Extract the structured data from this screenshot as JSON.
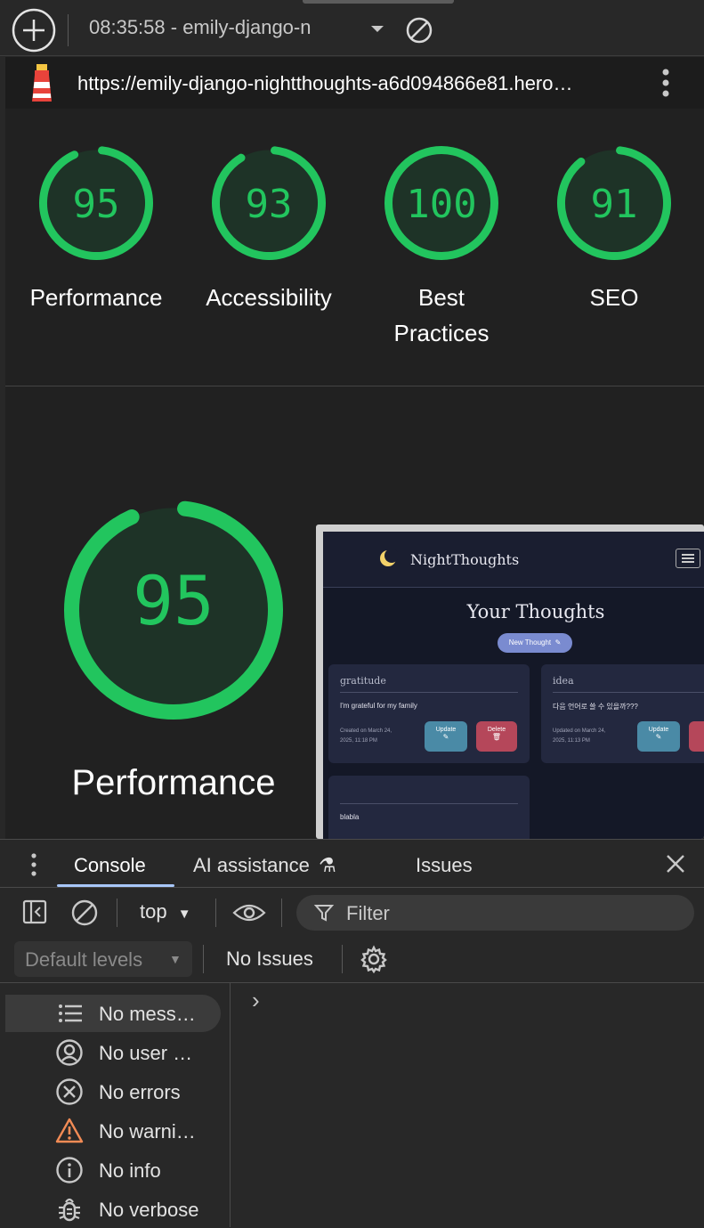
{
  "toolbar": {
    "session_label": "08:35:58 - emily-django-n",
    "add_icon": "plus-circle-icon",
    "clear_icon": "block-icon"
  },
  "url_bar": {
    "url": "https://emily-django-nightthoughts-a6d094866e81.hero…",
    "logo_icon": "lighthouse-icon",
    "menu_icon": "kebab-menu-icon"
  },
  "scores": [
    {
      "value": "95",
      "label": "Performance"
    },
    {
      "value": "93",
      "label": "Accessibility"
    },
    {
      "value": "100",
      "label": "Best Practices"
    },
    {
      "value": "91",
      "label": "SEO"
    }
  ],
  "main_score": {
    "value": "95",
    "label": "Performance"
  },
  "colors": {
    "pass": "#22c55e",
    "delete": "#b5475a",
    "update": "#4a8aa6",
    "accent": "#7a8bd0"
  },
  "screenshot": {
    "brand": "NightThoughts",
    "heading": "Your Thoughts",
    "new_thought_button": "New Thought",
    "cards": [
      {
        "tag": "gratitude",
        "text": "I'm grateful for my family",
        "meta1": "Created on March 24,",
        "meta2": "2025, 11:18 PM",
        "update": "Update",
        "delete": "Delete"
      },
      {
        "tag": "idea",
        "text": "다음 언어로 쓸 수 있을까???",
        "meta1": "Updated on March 24,",
        "meta2": "2025, 11:13 PM",
        "update": "Update",
        "delete": "D"
      },
      {
        "tag": "",
        "text": "blabla"
      }
    ]
  },
  "devtools": {
    "tabs": [
      "Console",
      "AI assistance",
      "Issues"
    ],
    "context": "top",
    "filter_placeholder": "Filter",
    "levels": "Default levels",
    "issues": "No Issues",
    "sidebar": [
      {
        "label": "No mess…",
        "icon": "list-icon"
      },
      {
        "label": "No user …",
        "icon": "user-circle-icon"
      },
      {
        "label": "No errors",
        "icon": "error-circle-icon"
      },
      {
        "label": "No warni…",
        "icon": "warning-triangle-icon"
      },
      {
        "label": "No info",
        "icon": "info-circle-icon"
      },
      {
        "label": "No verbose",
        "icon": "bug-icon"
      }
    ],
    "prompt": "›"
  }
}
